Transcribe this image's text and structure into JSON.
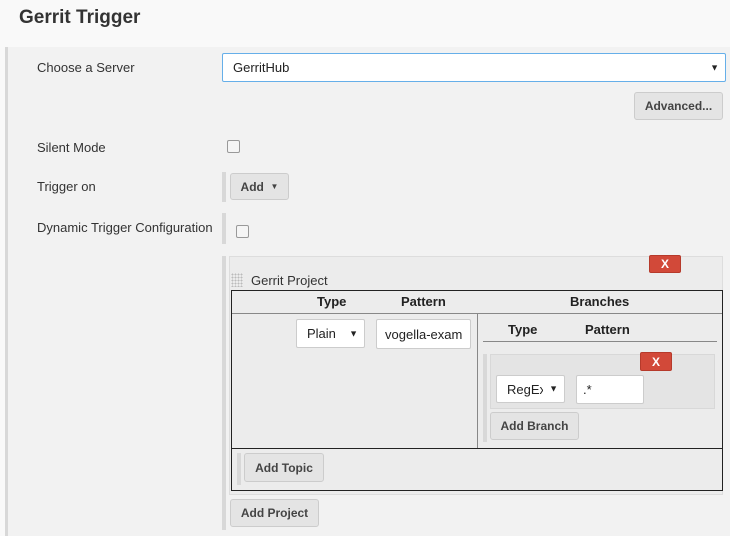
{
  "title": "Gerrit Trigger",
  "server": {
    "label": "Choose a Server",
    "value": "GerritHub",
    "advanced": "Advanced..."
  },
  "silent": {
    "label": "Silent Mode",
    "checked": false
  },
  "trigger_on": {
    "label": "Trigger on",
    "add": "Add"
  },
  "dynamic": {
    "label": "Dynamic Trigger Configuration",
    "checked": false
  },
  "project": {
    "heading": "Gerrit Project",
    "delete": "X",
    "col_type": "Type",
    "col_pattern": "Pattern",
    "col_branches": "Branches",
    "type": "Plain",
    "pattern": "vogella-example",
    "branches": {
      "col_type": "Type",
      "col_pattern": "Pattern",
      "delete": "X",
      "type": "RegEx",
      "pattern": ".*",
      "add_branch": "Add Branch"
    },
    "add_topic": "Add Topic"
  },
  "add_project": "Add Project",
  "colors": {
    "delete": "#d24939",
    "focus": "#66afe9"
  }
}
